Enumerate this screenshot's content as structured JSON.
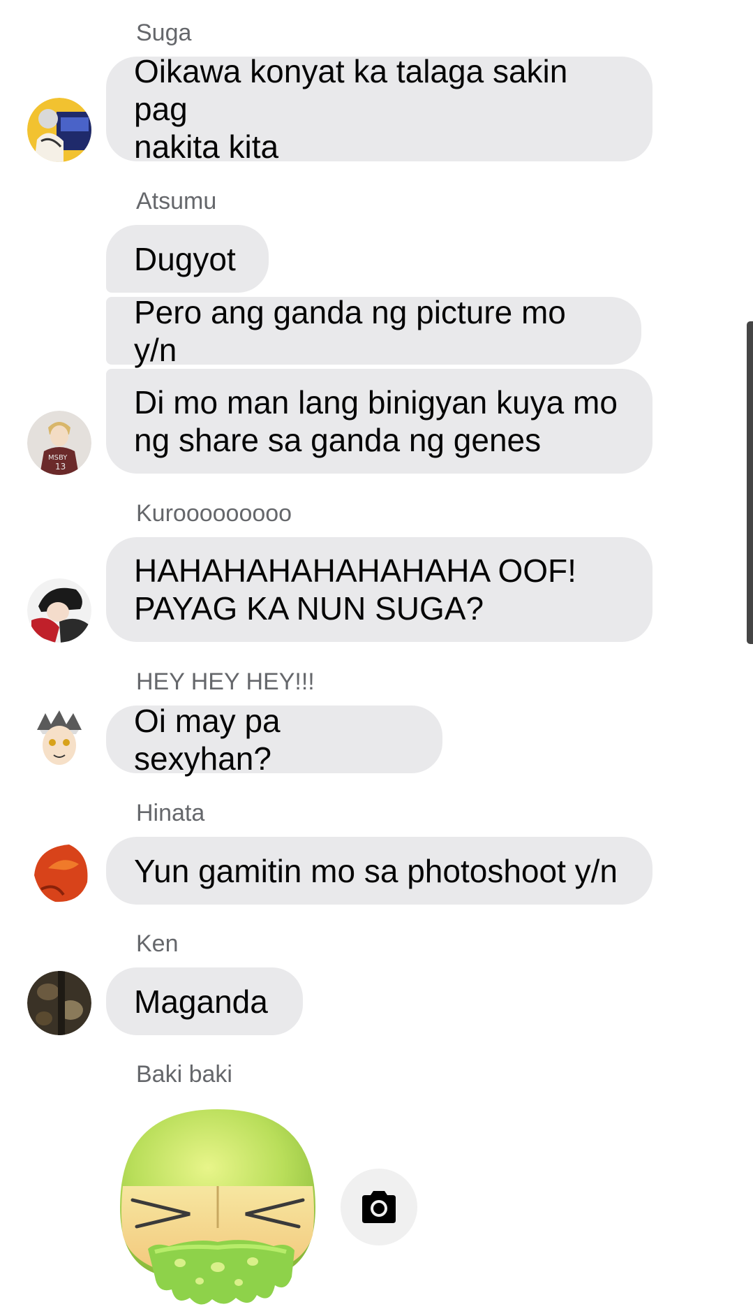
{
  "groups": [
    {
      "sender": "Suga",
      "avatar": "suga-avatar",
      "messages": [
        "Oikawa konyat ka talaga sakin pag\nnakita kita"
      ]
    },
    {
      "sender": "Atsumu",
      "avatar": "atsumu-avatar",
      "messages": [
        "Dugyot",
        "Pero ang ganda ng picture mo y/n",
        "Di mo man lang binigyan kuya mo\nng share sa ganda ng genes"
      ]
    },
    {
      "sender": "Kurooooooooo",
      "avatar": "kuroo-avatar",
      "messages": [
        "HAHAHAHAHAHAHAHA OOF!\nPAYAG KA NUN SUGA?"
      ]
    },
    {
      "sender": "HEY HEY HEY!!!",
      "avatar": "bokuto-avatar",
      "messages": [
        "Oi may pa sexyhan?"
      ]
    },
    {
      "sender": "Hinata",
      "avatar": "hinata-avatar",
      "messages": [
        "Yun gamitin mo sa photoshoot y/n"
      ]
    },
    {
      "sender": "Ken",
      "avatar": "ken-avatar",
      "messages": [
        "Maganda"
      ]
    },
    {
      "sender": "Baki baki",
      "sticker": "vomiting-face-sticker",
      "action_icon": "camera-icon"
    }
  ],
  "colors": {
    "bubble": "#e9e9eb",
    "sender_text": "#65676b",
    "message_text": "#050505",
    "camera_button": "#f0f0f0"
  }
}
